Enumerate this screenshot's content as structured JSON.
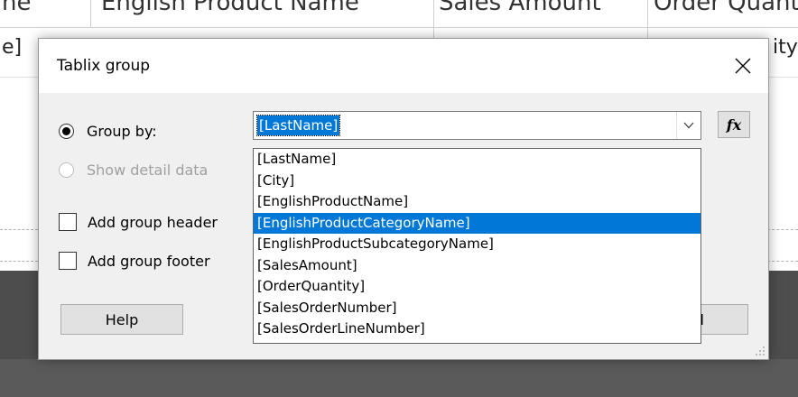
{
  "background": {
    "header_cells": [
      "ne",
      "English Product Name",
      "Sales Amount",
      "Order Quantity"
    ],
    "row_cells": [
      "e]",
      "ity"
    ]
  },
  "dialog": {
    "title": "Tablix group",
    "group_by_label": "Group by:",
    "show_detail_label": "Show detail data",
    "add_header_label": "Add group header",
    "add_footer_label": "Add group footer",
    "combo_value": "[LastName]",
    "fx_label": "fx",
    "help_label": "Help",
    "cancel_label_visible": "el"
  },
  "dropdown": {
    "options": [
      "[LastName]",
      "[City]",
      "[EnglishProductName]",
      "[EnglishProductCategoryName]",
      "[EnglishProductSubcategoryName]",
      "[SalesAmount]",
      "[OrderQuantity]",
      "[SalesOrderNumber]",
      "[SalesOrderLineNumber]"
    ],
    "selected_index": 3
  },
  "colors": {
    "selection": "#0078d7",
    "dialog_bg": "#f0f0f0",
    "dark_bg": "#4d4d4d"
  },
  "icons": {
    "close": "close-icon",
    "combo_arrow": "chevron-down-icon",
    "grip": "resize-grip-icon"
  }
}
